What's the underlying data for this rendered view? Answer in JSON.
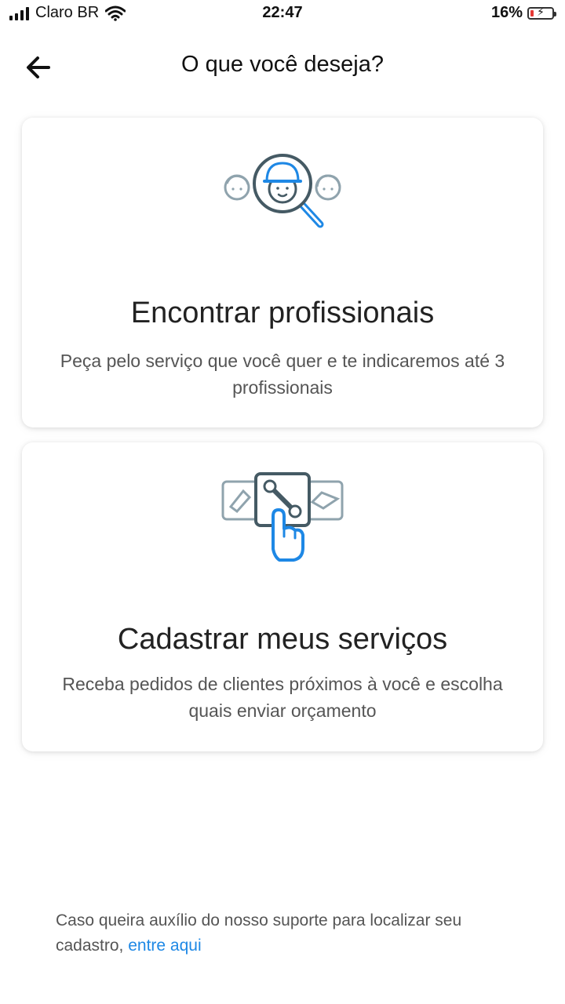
{
  "status_bar": {
    "carrier": "Claro BR",
    "time": "22:47",
    "battery_percent": "16%",
    "battery_level": 0.16,
    "icons": [
      "signal-icon",
      "wifi-icon",
      "battery-icon"
    ]
  },
  "header": {
    "title": "O que você deseja?",
    "back_icon": "arrow-left-icon"
  },
  "options": [
    {
      "title": "Encontrar profissionais",
      "description": "Peça pelo serviço que você quer e te indicaremos até 3 profissionais",
      "icon": "search-professionals-icon"
    },
    {
      "title": "Cadastrar meus serviços",
      "description": "Receba pedidos de clientes próximos à você e escolha quais enviar orçamento",
      "icon": "register-services-icon"
    }
  ],
  "footer": {
    "text": "Caso queira auxílio do nosso suporte para localizar seu cadastro, ",
    "link_label": "entre aqui"
  },
  "colors": {
    "accent": "#1e88e5",
    "icon_gray": "#8fa3ad",
    "icon_dark": "#455a64",
    "battery_low": "#e53935"
  }
}
